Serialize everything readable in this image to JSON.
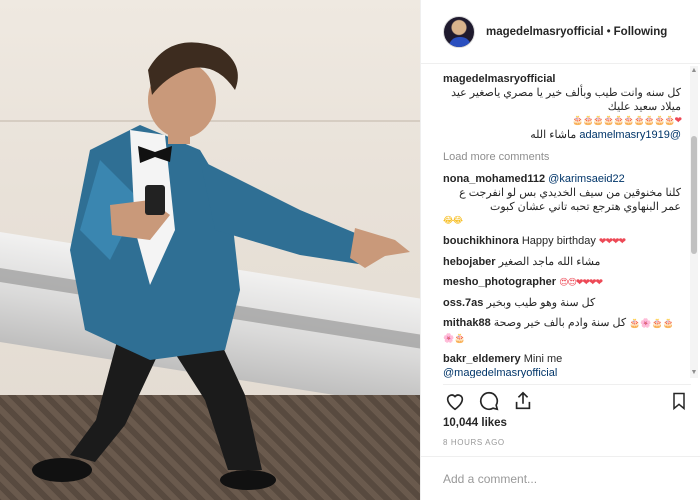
{
  "post": {
    "username": "magedelmasryofficial",
    "separator": "•",
    "follow_status": "Following"
  },
  "caption": {
    "username": "magedelmasryofficial",
    "text": "كل سنه وانت طيب وبألف خير يا مصري ياصغير عيد ميلاد سعيد عليك",
    "emojis": "❤🎂🎂🎂🎂🎂🎂🎂🎂🎂🎂",
    "mention": "@adamelmasry1919",
    "tail": "ماشاء الله"
  },
  "load_more": "Load more comments",
  "comments": [
    {
      "user": "nona_mohamed112",
      "mention": "@karimsaeid22",
      "text": "كلنا مخنوقين من سيف الخديدي بس لو انفرجت ع عمر البنهاوي هترجع تحبه تاني عشان كبوت",
      "emoji": "😂😂"
    },
    {
      "user": "bouchikhinora",
      "text": "Happy birthday",
      "emoji": "❤❤❤❤"
    },
    {
      "user": "hebojaber",
      "text": "مشاء الله ماجد الصغير"
    },
    {
      "user": "mesho_photographer",
      "text": "",
      "emoji": "😍😍❤❤❤❤"
    },
    {
      "user": "oss.7as",
      "text": "كل سنة وهو طيب وبخير"
    },
    {
      "user": "mithak88",
      "text": "كل سنة وادم بالف خير وصحة",
      "emoji": "🎂🌸🎂🎂🌸🎂"
    },
    {
      "user": "bakr_eldemery",
      "text": "Mini me",
      "mention": "@magedelmasryofficial"
    }
  ],
  "actions": {
    "like_icon": "heart-outline-icon",
    "comment_icon": "speech-bubble-icon",
    "share_icon": "share-icon",
    "save_icon": "bookmark-icon"
  },
  "likes": "10,044 likes",
  "timestamp": "8 HOURS AGO",
  "add_comment": {
    "placeholder": "Add a comment..."
  },
  "colors": {
    "mention": "#003569",
    "text": "#262626",
    "muted": "#999999",
    "border": "#efefef"
  }
}
